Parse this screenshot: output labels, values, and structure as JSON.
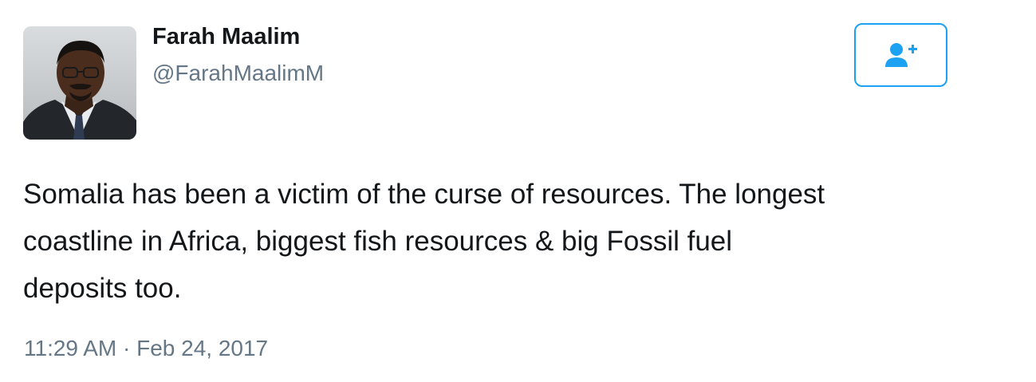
{
  "user": {
    "display_name": "Farah Maalim",
    "handle": "@FarahMaalimM",
    "avatar_icon": "profile-photo"
  },
  "follow_button": {
    "icon": "add-user-icon",
    "accent_color": "#1da1f2"
  },
  "tweet": {
    "text_lines": [
      "Somalia has been a victim of the curse of resources. The longest",
      "coastline in Africa, biggest fish resources & big Fossil fuel",
      "deposits too."
    ],
    "timestamp": "11:29 AM · Feb 24, 2017"
  },
  "colors": {
    "text": "#14171a",
    "secondary_text": "#657786",
    "accent": "#1da1f2"
  }
}
